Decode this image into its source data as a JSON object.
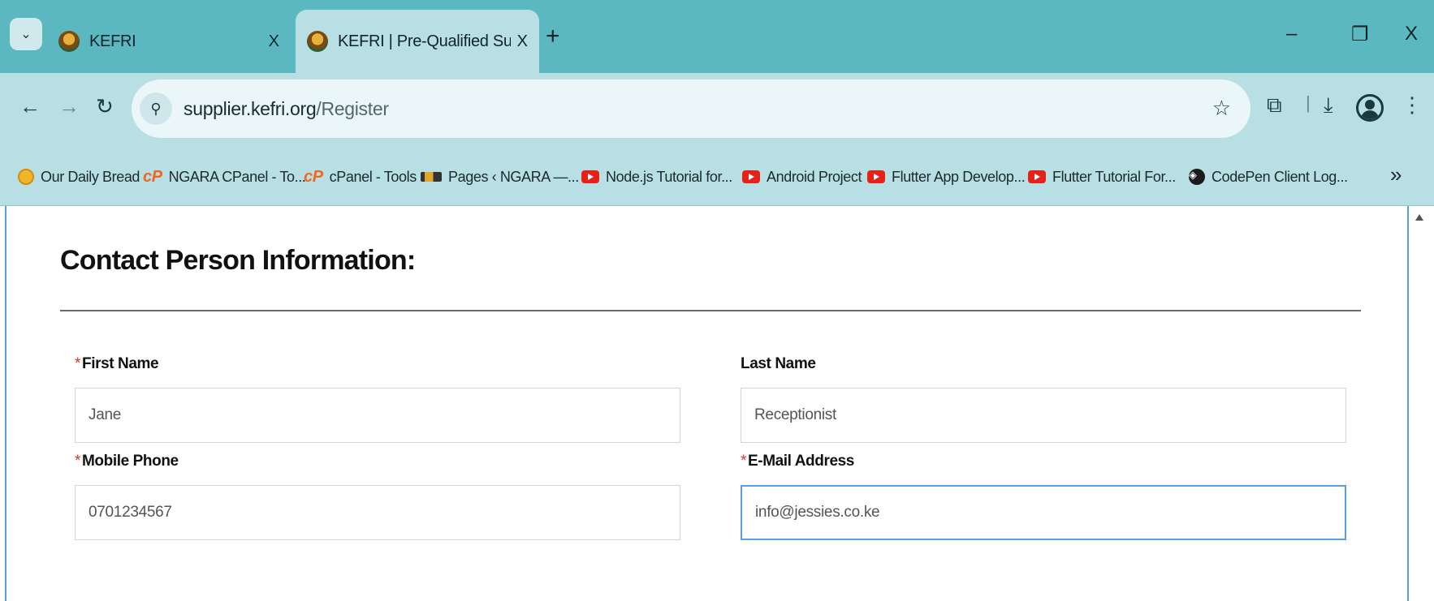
{
  "browser": {
    "tabs": [
      {
        "title": "KEFRI",
        "close": "X",
        "active": false
      },
      {
        "title": "KEFRI | Pre-Qualified Supplier A",
        "close": "X",
        "active": true
      }
    ],
    "new_tab": "+",
    "window_controls": {
      "minimize": "–",
      "restore": "❐",
      "close": "X"
    },
    "url_host": "supplier.kefri.org",
    "url_path": "/Register",
    "bookmarks": [
      {
        "label": "Our Daily Bread",
        "icon": "bread-icon"
      },
      {
        "label": "NGARA CPanel - To...",
        "icon": "cpanel-icon"
      },
      {
        "label": "cPanel - Tools",
        "icon": "cpanel-icon"
      },
      {
        "label": "Pages ‹ NGARA —...",
        "icon": "ngara-icon"
      },
      {
        "label": "Node.js Tutorial for...",
        "icon": "youtube-icon"
      },
      {
        "label": "Android Project",
        "icon": "youtube-icon"
      },
      {
        "label": "Flutter App Develop...",
        "icon": "youtube-icon"
      },
      {
        "label": "Flutter Tutorial For...",
        "icon": "youtube-icon"
      },
      {
        "label": "CodePen Client Log...",
        "icon": "codepen-icon"
      }
    ],
    "bookmarks_more": "»"
  },
  "form": {
    "section_title": "Contact Person Information:",
    "required_mark": "*",
    "first_name": {
      "label": "First Name",
      "value": "Jane",
      "required": true
    },
    "last_name": {
      "label": "Last Name",
      "value": "Receptionist",
      "required": false
    },
    "mobile_phone": {
      "label": "Mobile Phone",
      "value": "0701234567",
      "required": true
    },
    "email": {
      "label": "E-Mail Address",
      "value": "info@jessies.co.ke",
      "required": true
    }
  },
  "colors": {
    "tabstrip": "#5bb8c1",
    "toolbar": "#b8dfe3",
    "required": "#d9342b",
    "focus": "#5b9fe0"
  }
}
